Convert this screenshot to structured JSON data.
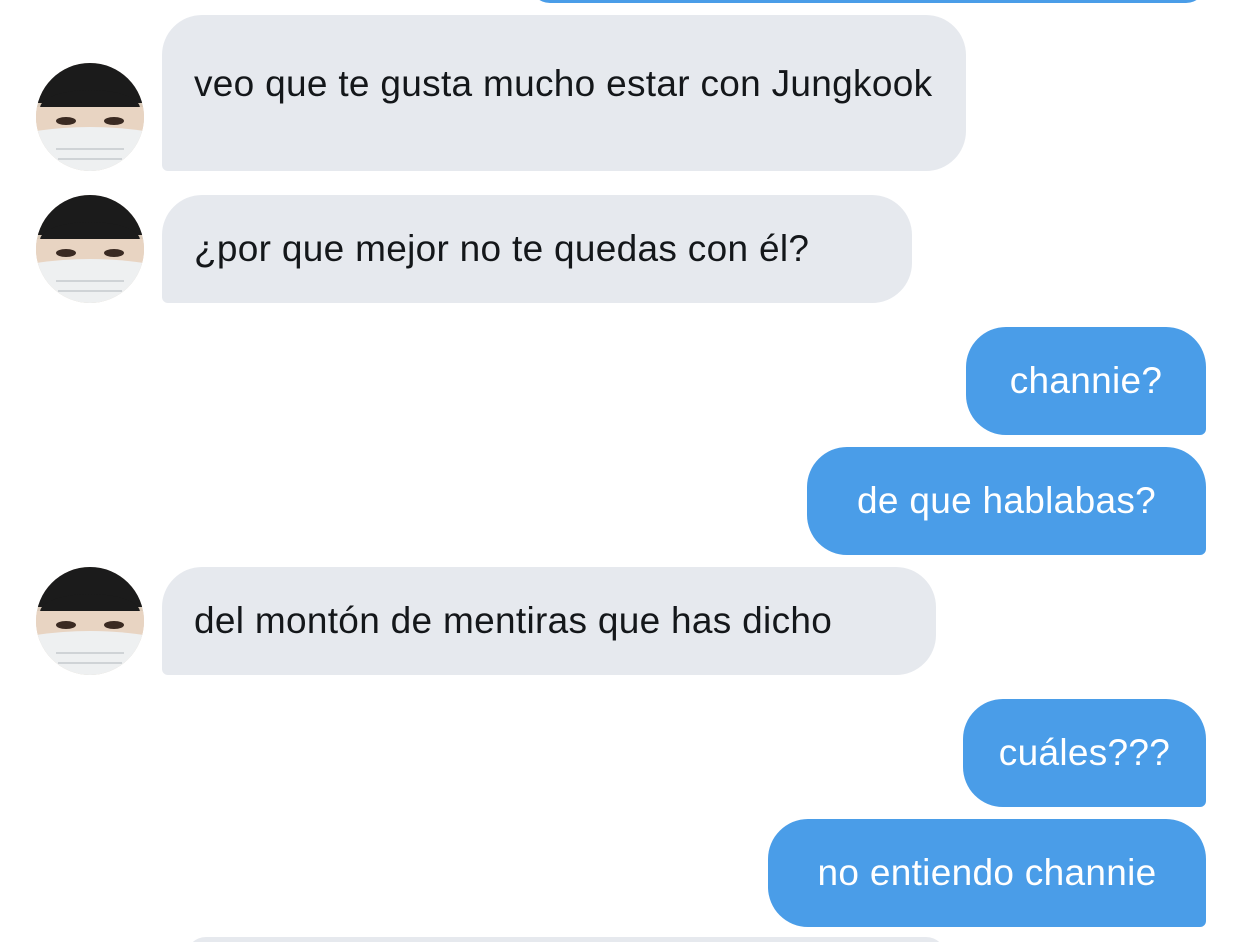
{
  "colors": {
    "incoming_bubble": "#e6e9ee",
    "outgoing_bubble": "#4a9de8",
    "incoming_text": "#14171a",
    "outgoing_text": "#ffffff"
  },
  "messages": [
    {
      "direction": "incoming",
      "text": "veo que te gusta mucho estar con Jungkook"
    },
    {
      "direction": "incoming",
      "text": "¿por que mejor no te quedas con él?"
    },
    {
      "direction": "outgoing",
      "text": "channie?"
    },
    {
      "direction": "outgoing",
      "text": "de que hablabas?"
    },
    {
      "direction": "incoming",
      "text": "del montón de mentiras que has dicho"
    },
    {
      "direction": "outgoing",
      "text": "cuáles???"
    },
    {
      "direction": "outgoing",
      "text": "no entiendo channie"
    }
  ],
  "avatar_icon": "profile-photo-masked-person"
}
